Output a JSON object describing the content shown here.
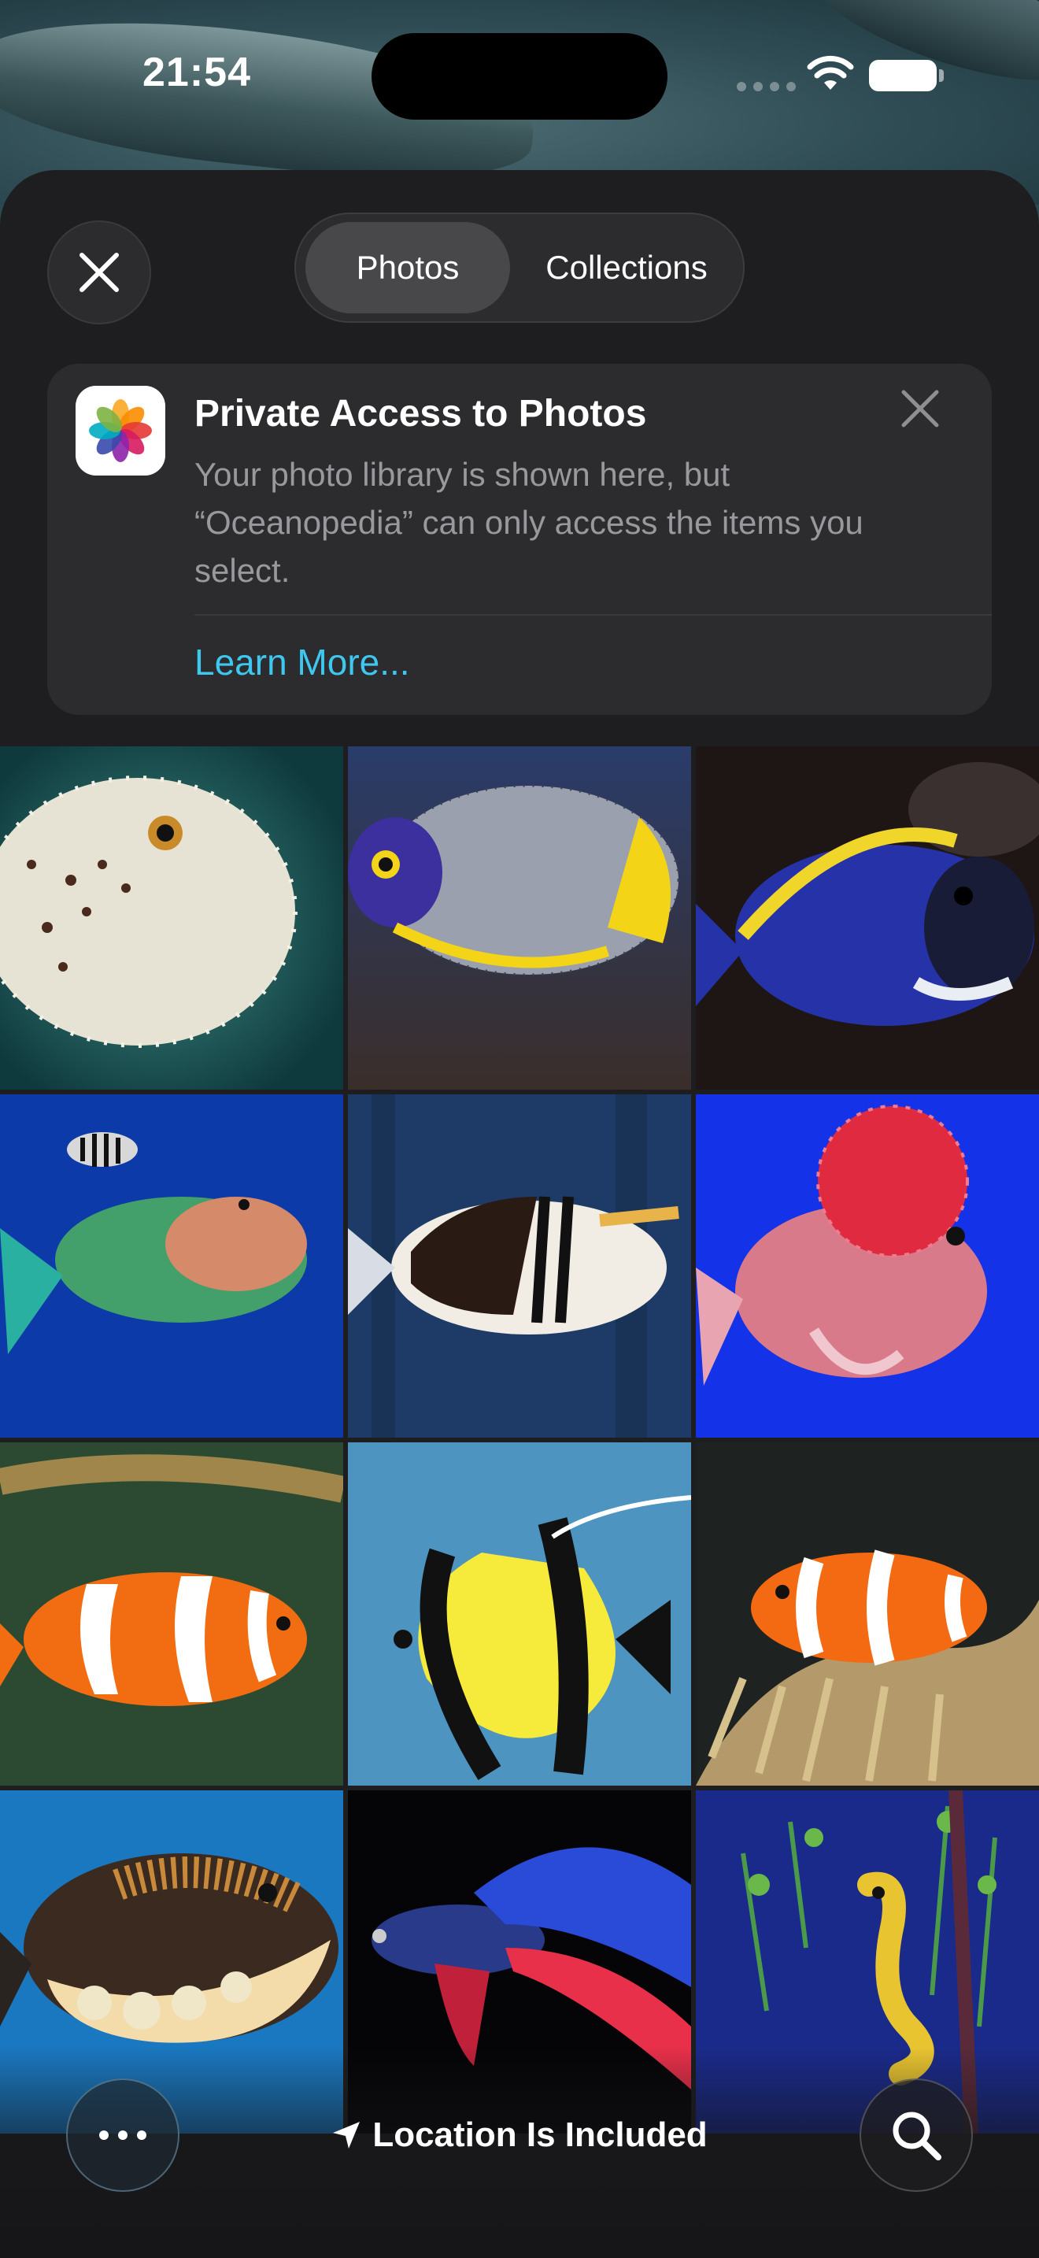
{
  "status_bar": {
    "time": "21:54",
    "icons": [
      "cellular-signal-icon",
      "wifi-icon",
      "battery-icon"
    ]
  },
  "picker": {
    "close_icon": "close-icon",
    "tabs": [
      {
        "label": "Photos",
        "selected": true
      },
      {
        "label": "Collections",
        "selected": false
      }
    ]
  },
  "banner": {
    "icon": "photos-app-icon",
    "title": "Private Access to Photos",
    "body": "Your photo library is shown here, but “Oceanopedia” can only access the items you select.",
    "link": "Learn More...",
    "dismiss_icon": "close-icon",
    "link_color": "#3ec8f0"
  },
  "photos": [
    {
      "subject": "porcupine pufferfish"
    },
    {
      "subject": "blue-faced angelfish"
    },
    {
      "subject": "powder blue tang"
    },
    {
      "subject": "parrotfish"
    },
    {
      "subject": "picasso triggerfish"
    },
    {
      "subject": "flowerhorn cichlid"
    },
    {
      "subject": "clownfish"
    },
    {
      "subject": "moorish idol"
    },
    {
      "subject": "clownfish in anemone"
    },
    {
      "subject": "clown triggerfish"
    },
    {
      "subject": "betta fish"
    },
    {
      "subject": "seahorse"
    }
  ],
  "toolbar": {
    "more_icon": "ellipsis-icon",
    "location_icon": "location-arrow-icon",
    "location_label": "Location Is Included",
    "search_icon": "search-icon"
  },
  "colors": {
    "sheet_background": "#1e1e20",
    "banner_background": "#2c2c2e",
    "secondary_text": "#98989d",
    "accent": "#3ec8f0"
  }
}
